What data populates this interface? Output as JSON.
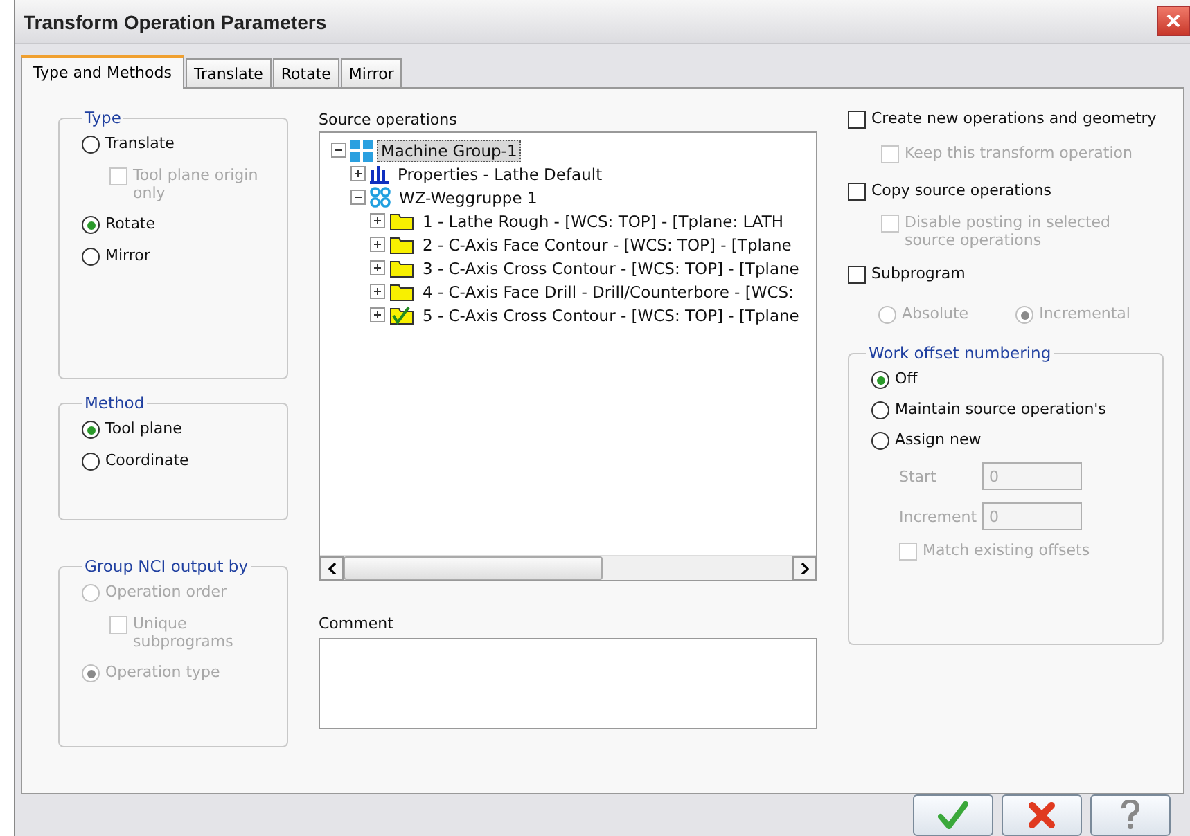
{
  "window": {
    "title": "Transform Operation Parameters"
  },
  "tabs": [
    {
      "label": "Type and Methods",
      "selected": true
    },
    {
      "label": "Translate",
      "selected": false
    },
    {
      "label": "Rotate",
      "selected": false
    },
    {
      "label": "Mirror",
      "selected": false
    }
  ],
  "type_group": {
    "title": "Type",
    "items": [
      {
        "kind": "radio",
        "label": "Translate",
        "selected": false,
        "disabled": false
      },
      {
        "kind": "checkbox",
        "label": "Tool plane origin only",
        "checked": false,
        "disabled": true
      },
      {
        "kind": "radio",
        "label": "Rotate",
        "selected": true,
        "disabled": false
      },
      {
        "kind": "radio",
        "label": "Mirror",
        "selected": false,
        "disabled": false
      }
    ]
  },
  "method_group": {
    "title": "Method",
    "items": [
      {
        "kind": "radio",
        "label": "Tool plane",
        "selected": true,
        "disabled": false
      },
      {
        "kind": "radio",
        "label": "Coordinate",
        "selected": false,
        "disabled": false
      }
    ]
  },
  "nci_group": {
    "title": "Group NCI output by",
    "items": [
      {
        "kind": "radio",
        "label": "Operation order",
        "selected": false,
        "disabled": true
      },
      {
        "kind": "checkbox",
        "label": "Unique subprograms",
        "checked": false,
        "disabled": true
      },
      {
        "kind": "radio",
        "label": "Operation type",
        "selected": true,
        "disabled": true
      }
    ]
  },
  "source_operations": {
    "label": "Source operations",
    "tree": [
      {
        "kind": "machine-group",
        "label": "Machine Group-1",
        "expanded": true,
        "selected": true,
        "children": [
          {
            "kind": "properties",
            "label": "Properties - Lathe Default",
            "expanded": false,
            "selected": false
          },
          {
            "kind": "toolpath-group",
            "label": "WZ-Weggruppe 1",
            "expanded": true,
            "selected": false,
            "children": [
              {
                "kind": "folder",
                "label": "1 - Lathe Rough - [WCS: TOP] - [Tplane: LATH",
                "expanded": false,
                "selected": false
              },
              {
                "kind": "folder",
                "label": "2 - C-Axis Face Contour - [WCS: TOP] - [Tplane",
                "expanded": false,
                "selected": false
              },
              {
                "kind": "folder",
                "label": "3 - C-Axis Cross Contour - [WCS: TOP] - [Tplane",
                "expanded": false,
                "selected": false
              },
              {
                "kind": "folder",
                "label": "4 - C-Axis Face Drill - Drill/Counterbore - [WCS: ",
                "expanded": false,
                "selected": false
              },
              {
                "kind": "folder-checked",
                "label": "5 - C-Axis Cross Contour - [WCS: TOP] - [Tplane",
                "expanded": false,
                "selected": false
              }
            ]
          }
        ]
      }
    ]
  },
  "comment": {
    "label": "Comment"
  },
  "options": [
    {
      "kind": "checkbox",
      "label": "Create new operations and geometry",
      "checked": false,
      "disabled": false
    },
    {
      "kind": "sub-checkbox",
      "label": "Keep this transform operation",
      "checked": false,
      "disabled": true
    },
    {
      "kind": "checkbox",
      "label": "Copy source operations",
      "checked": false,
      "disabled": false
    },
    {
      "kind": "sub-checkbox",
      "label": "Disable posting in selected source operations",
      "checked": false,
      "disabled": true
    },
    {
      "kind": "checkbox",
      "label": "Subprogram",
      "checked": false,
      "disabled": false
    }
  ],
  "subprogram_mode": [
    {
      "label": "Absolute",
      "selected": false,
      "disabled": true
    },
    {
      "label": "Incremental",
      "selected": true,
      "disabled": true
    }
  ],
  "work_offset": {
    "title": "Work offset numbering",
    "items": [
      {
        "kind": "radio",
        "label": "Off",
        "selected": true,
        "disabled": false
      },
      {
        "kind": "radio",
        "label": "Maintain source operation's",
        "selected": false,
        "disabled": false
      },
      {
        "kind": "radio",
        "label": "Assign new",
        "selected": false,
        "disabled": false
      },
      {
        "kind": "field",
        "label": "Start",
        "value": "0",
        "disabled": true
      },
      {
        "kind": "field",
        "label": "Increment",
        "value": "0",
        "disabled": true
      },
      {
        "kind": "checkbox",
        "label": "Match existing offsets",
        "checked": false,
        "disabled": true
      }
    ]
  },
  "buttons": [
    {
      "kind": "ok"
    },
    {
      "kind": "cancel"
    },
    {
      "kind": "help"
    }
  ]
}
